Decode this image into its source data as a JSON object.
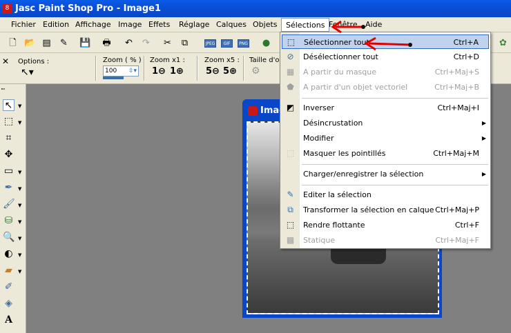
{
  "window": {
    "title": "Jasc Paint Shop Pro - Image1",
    "icon": "8"
  },
  "menubar": [
    "Fichier",
    "Edition",
    "Affichage",
    "Image",
    "Effets",
    "Réglage",
    "Calques",
    "Objets",
    "Sélections",
    "Fenêtre",
    "Aide"
  ],
  "toolbar": {
    "formats": [
      "JPEG",
      "GIF",
      "PNG"
    ]
  },
  "options": {
    "label": "Options :",
    "zoom_label": "Zoom ( % )",
    "zoom_value": "100",
    "zoom_x1": "Zoom x1 :",
    "zoom_x5": "Zoom x5 :",
    "taille": "Taille d'orig",
    "z1_in": "1",
    "z1_out": "1",
    "z5_in": "5",
    "z5_out": "5"
  },
  "image_window": {
    "title": "Image"
  },
  "selections_menu": [
    {
      "label": "Sélectionner tout",
      "shortcut": "Ctrl+A",
      "icon": "select-all-icon",
      "enabled": true,
      "highlighted": true
    },
    {
      "label": "Désélectionner tout",
      "shortcut": "Ctrl+D",
      "icon": "deselect-icon",
      "enabled": true
    },
    {
      "label": "A partir du masque",
      "shortcut": "Ctrl+Maj+S",
      "icon": "from-mask-icon",
      "enabled": false
    },
    {
      "label": "A partir d'un objet vectoriel",
      "shortcut": "Ctrl+Maj+B",
      "icon": "from-vector-icon",
      "enabled": false
    },
    {
      "label": "Inverser",
      "shortcut": "Ctrl+Maj+I",
      "icon": "invert-icon",
      "enabled": true
    },
    {
      "label": "Désincrustation",
      "shortcut": "",
      "icon": "",
      "enabled": true,
      "submenu": true
    },
    {
      "label": "Modifier",
      "shortcut": "",
      "icon": "",
      "enabled": true,
      "submenu": true
    },
    {
      "label": "Masquer les pointillés",
      "shortcut": "Ctrl+Maj+M",
      "icon": "hide-marquee-icon",
      "enabled": true
    },
    {
      "label": "Charger/enregistrer la sélection",
      "shortcut": "",
      "icon": "",
      "enabled": true,
      "submenu": true
    },
    {
      "label": "Editer la sélection",
      "shortcut": "",
      "icon": "edit-selection-icon",
      "enabled": true
    },
    {
      "label": "Transformer la sélection en calque",
      "shortcut": "Ctrl+Maj+P",
      "icon": "promote-layer-icon",
      "enabled": true
    },
    {
      "label": "Rendre flottante",
      "shortcut": "Ctrl+F",
      "icon": "float-icon",
      "enabled": true
    },
    {
      "label": "Statique",
      "shortcut": "Ctrl+Maj+F",
      "icon": "defloat-icon",
      "enabled": false
    }
  ],
  "annotation_color": "#e00000",
  "highlight_color": "#c1d2ee"
}
